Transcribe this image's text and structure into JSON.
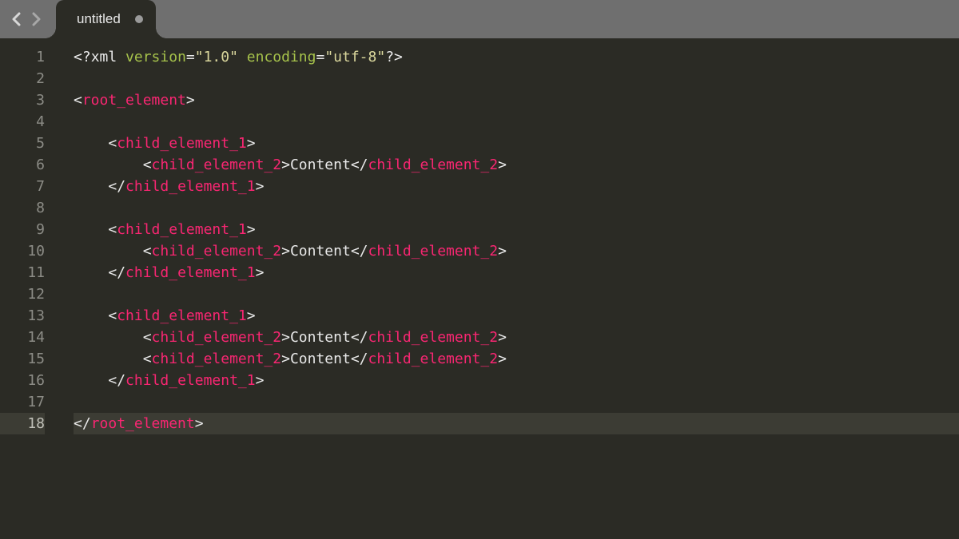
{
  "tab": {
    "title": "untitled",
    "dirty": true
  },
  "cursor_line": 18,
  "xml_decl": {
    "target": "xml",
    "attrs": [
      {
        "name": "version",
        "value": "\"1.0\""
      },
      {
        "name": "encoding",
        "value": "\"utf-8\""
      }
    ]
  },
  "tags": {
    "root": "root_element",
    "child1": "child_element_1",
    "child2": "child_element_2"
  },
  "content_text": "Content",
  "line_count": 18
}
